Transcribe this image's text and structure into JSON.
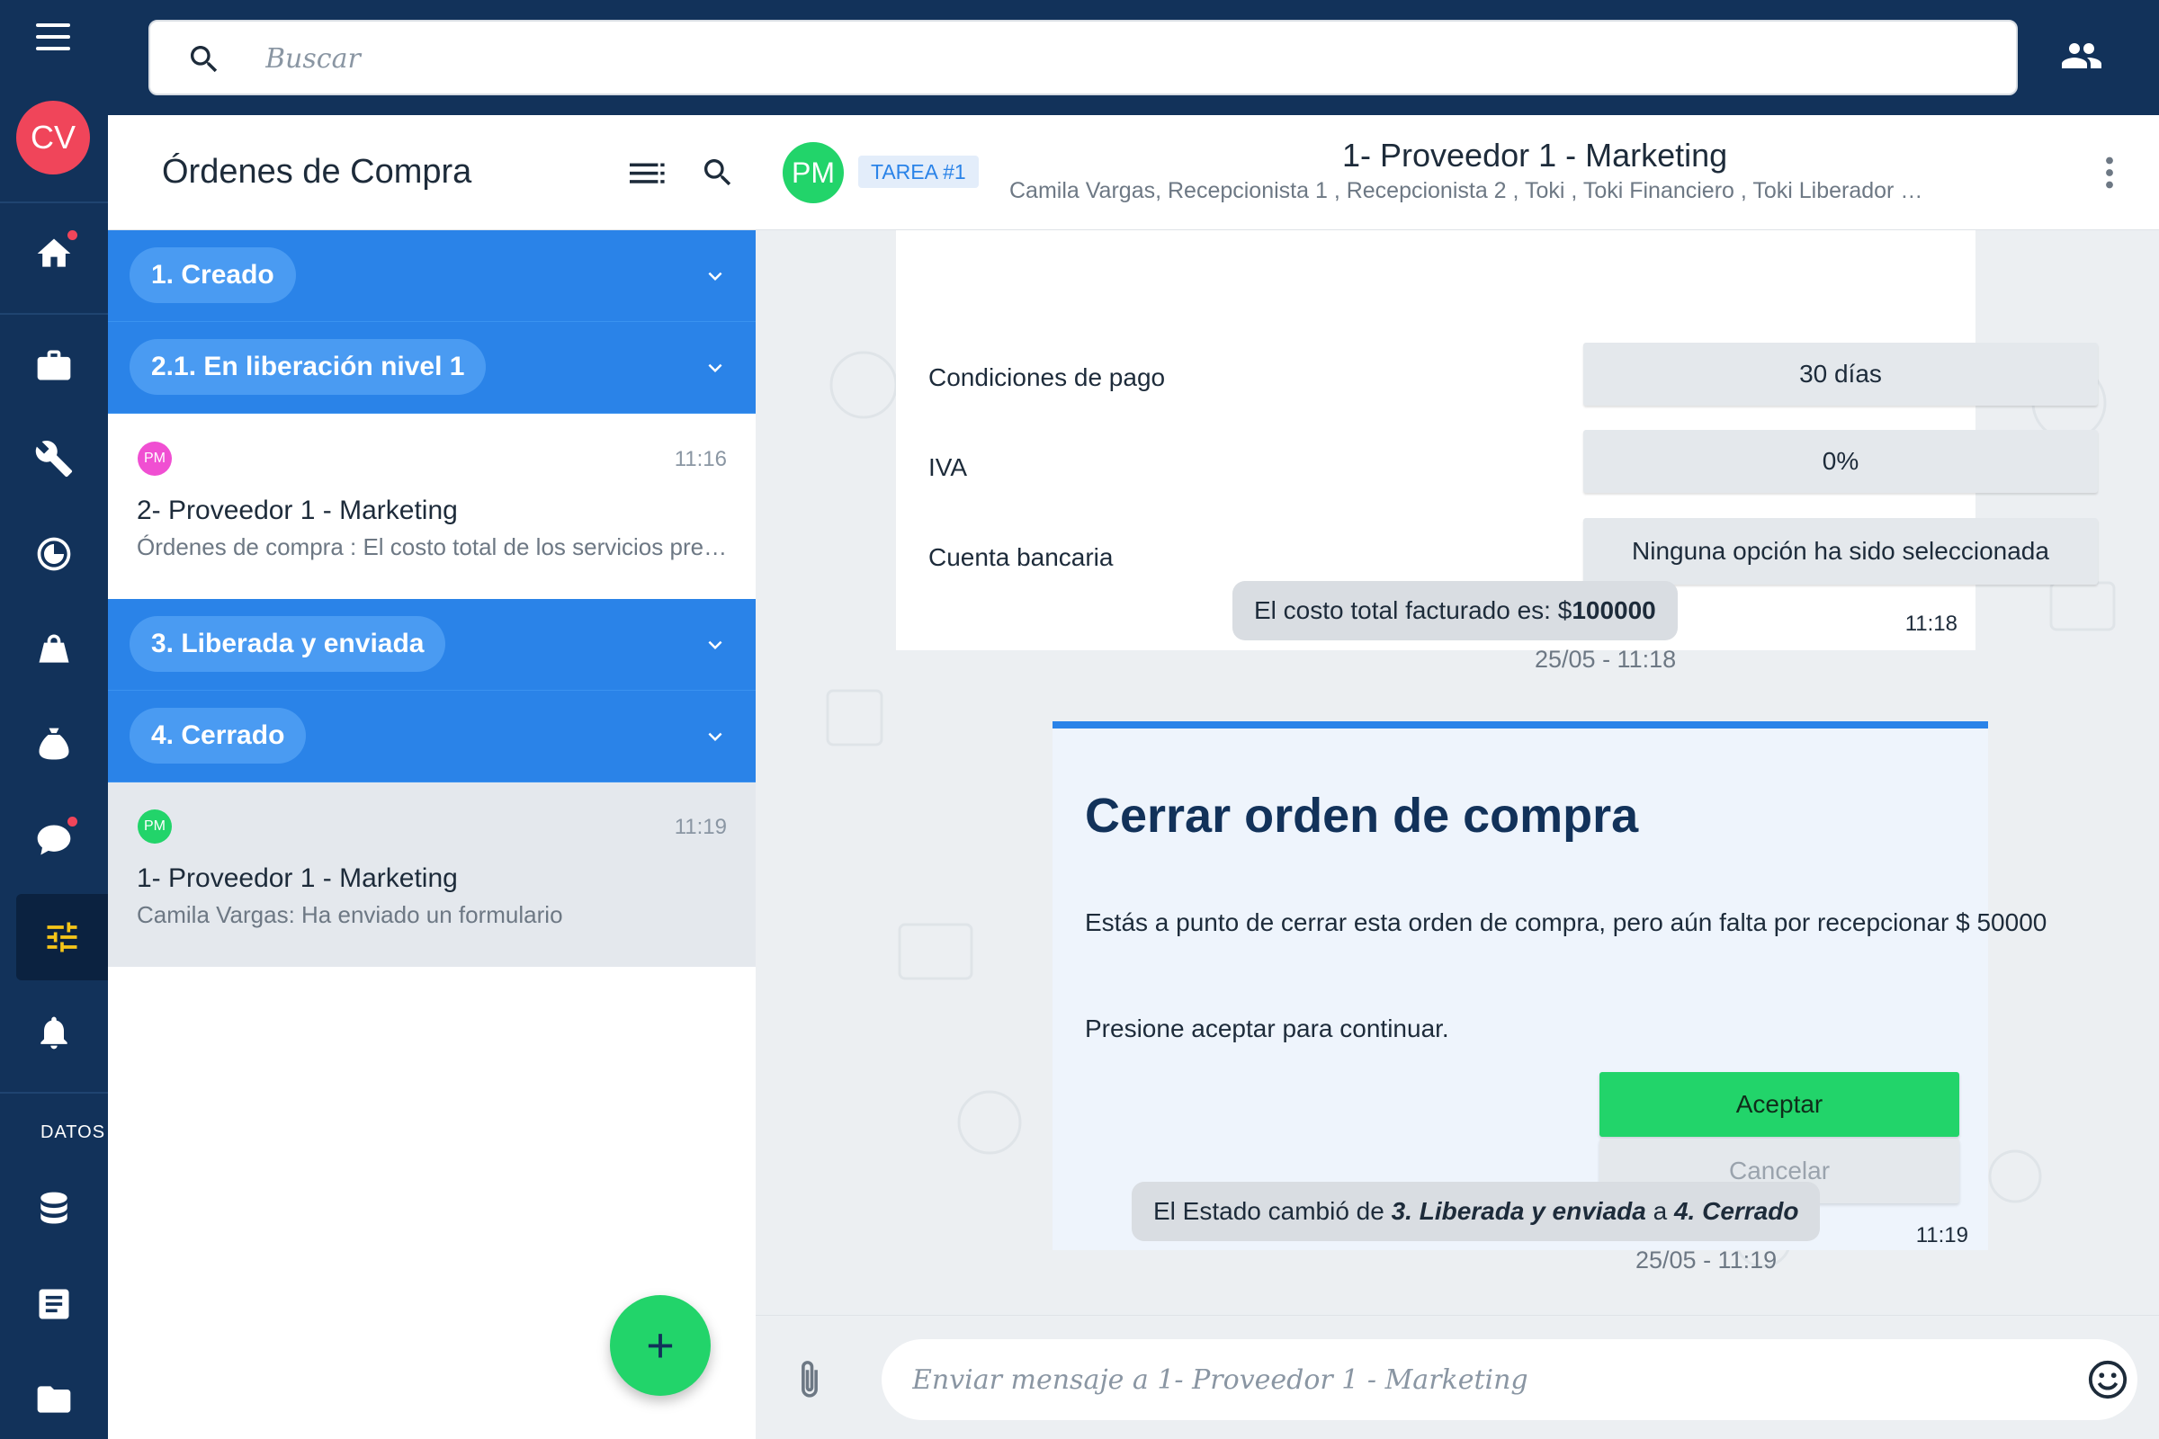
{
  "topbar": {
    "search_placeholder": "Buscar"
  },
  "rail": {
    "avatar_initials": "CV",
    "section_label": "DATOS"
  },
  "list": {
    "title": "Órdenes de Compra",
    "groups": [
      {
        "label": "1. Creado"
      },
      {
        "label": "2.1. En liberación nivel 1"
      },
      {
        "label": "3. Liberada y enviada"
      },
      {
        "label": "4. Cerrado"
      }
    ],
    "items": [
      {
        "avatar": "PM",
        "avatar_color": "#f04fd2",
        "time": "11:16",
        "title": "2- Proveedor 1 - Marketing",
        "subtitle": "Órdenes de compra : El costo total de los servicios prestados es..."
      },
      {
        "avatar": "PM",
        "avatar_color": "#22d46a",
        "time": "11:19",
        "title": "1- Proveedor 1 - Marketing",
        "subtitle": "Camila Vargas: Ha enviado un formulario"
      }
    ],
    "fab_label": "+"
  },
  "chat": {
    "avatar": "PM",
    "tag": "TAREA #1",
    "title": "1- Proveedor 1 - Marketing",
    "members": "Camila Vargas, Recepcionista 1 , Recepcionista 2 , Toki , Toki Financiero , Toki Liberador , Toki Recepcionista",
    "form": {
      "rows": [
        {
          "label": "Condiciones de pago",
          "value": "30 días"
        },
        {
          "label": "IVA",
          "value": "0%"
        },
        {
          "label": "Cuenta bancaria",
          "value": "Ninguna opción ha sido seleccionada"
        }
      ],
      "time": "11:18"
    },
    "cost_msg": {
      "prefix": "El costo total facturado es: $",
      "amount": "100000",
      "time": "25/05 - 11:18"
    },
    "close_card": {
      "heading": "Cerrar orden de compra",
      "description": "Estás a punto de cerrar esta orden de compra, pero aún falta por recepcionar $ 50000",
      "prompt": "Presione aceptar para continuar.",
      "accept_label": "Aceptar",
      "cancel_label": "Cancelar",
      "time": "11:19"
    },
    "status_msg": {
      "prefix": "El Estado cambió de ",
      "from": "3. Liberada y enviada",
      "joiner": " a ",
      "to": "4. Cerrado",
      "time": "25/05 - 11:19"
    },
    "composer_placeholder": "Enviar mensaje a 1- Proveedor 1 - Marketing"
  },
  "colors": {
    "sidebar": "#12325a",
    "accent": "#2a83e8",
    "success": "#22d46a",
    "avatar_red": "#f0455a"
  }
}
